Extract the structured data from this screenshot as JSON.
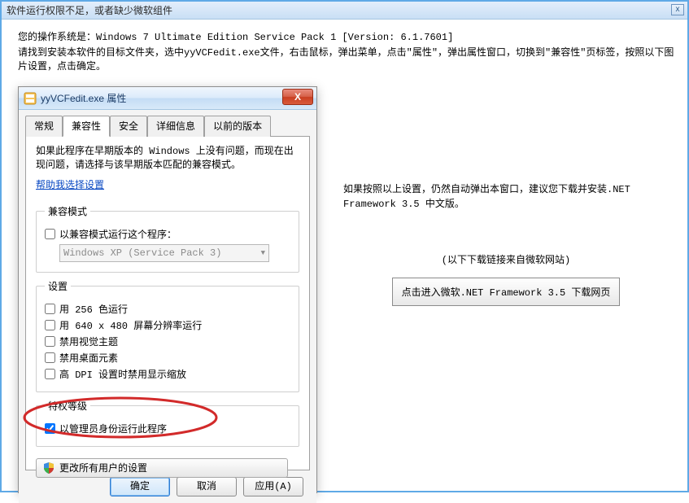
{
  "outer": {
    "title": "软件运行权限不足，或者缺少微软组件",
    "close": "x",
    "os_line_prefix": "您的操作系统是：",
    "os_line_value": "Windows 7 Ultimate Edition Service Pack 1 [Version: 6.1.7601]",
    "instruction": "请找到安装本软件的目标文件夹，选中yyVCFedit.exe文件，右击鼠标，弹出菜单，点击\"属性\"，弹出属性窗口，切换到\"兼容性\"页标签，按照以下图片设置，点击确定。"
  },
  "props": {
    "title": "yyVCFedit.exe 属性",
    "close": "X",
    "tabs": [
      "常规",
      "兼容性",
      "安全",
      "详细信息",
      "以前的版本"
    ],
    "active_tab_index": 1,
    "desc": "如果此程序在早期版本的 Windows 上没有问题，而现在出现问题，请选择与该早期版本匹配的兼容模式。",
    "help_link": "帮助我选择设置",
    "group_mode": {
      "legend": "兼容模式",
      "chk_label": "以兼容模式运行这个程序：",
      "chk_checked": false,
      "combo_text": "Windows XP (Service Pack 3)"
    },
    "group_settings": {
      "legend": "设置",
      "items": [
        {
          "label": "用 256 色运行",
          "checked": false
        },
        {
          "label": "用 640 x 480 屏幕分辨率运行",
          "checked": false
        },
        {
          "label": "禁用视觉主题",
          "checked": false
        },
        {
          "label": "禁用桌面元素",
          "checked": false
        },
        {
          "label": "高 DPI 设置时禁用显示缩放",
          "checked": false
        }
      ]
    },
    "group_priv": {
      "legend": "特权等级",
      "chk_label": "以管理员身份运行此程序",
      "chk_checked": true
    },
    "change_all_btn": "更改所有用户的设置",
    "buttons": {
      "ok": "确定",
      "cancel": "取消",
      "apply": "应用(A)"
    }
  },
  "right": {
    "line1": "如果按照以上设置，仍然自动弹出本窗口，建议您下载并安装.NET Framework 3.5 中文版。",
    "subnote": "(以下下载链接来自微软网站)",
    "dl_btn": "点击进入微软.NET Framework 3.5 下载网页"
  }
}
